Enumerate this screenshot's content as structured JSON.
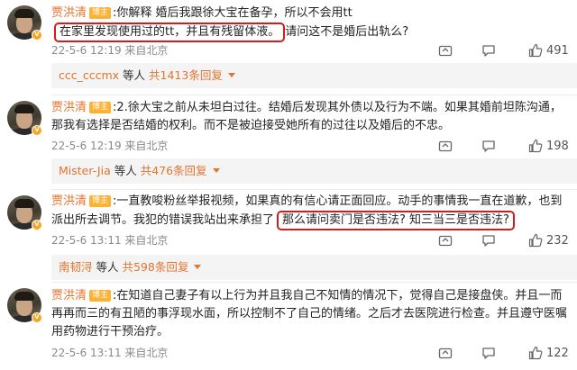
{
  "comments": [
    {
      "username": "贾洪清",
      "badge": "博主",
      "text_before": ":你解释 婚后我跟徐大宝在备孕，所以不会用tt",
      "highlight": "在家里发现使用过的tt，并且有残留体液。",
      "text_after": "请问这不是婚后出轨么?",
      "time": "22-5-6 12:19 来自北京",
      "likes": "491",
      "reply_user": "ccc_cccmx",
      "reply_mid": " 等人 ",
      "reply_count": "共1413条回复"
    },
    {
      "username": "贾洪清",
      "badge": "博主",
      "text_before": ":2.徐大宝之前从未坦白过往。结婚后发现其外债以及行为不端。如果其婚前坦陈沟通，那我有选择是否结婚的权利。而不是被迫接受她所有的过往以及婚后的不忠。",
      "highlight": "",
      "text_after": "",
      "time": "22-5-6 12:19 来自北京",
      "likes": "198",
      "reply_user": "Mister-Jia",
      "reply_mid": " 等人 ",
      "reply_count": "共476条回复"
    },
    {
      "username": "贾洪清",
      "badge": "博主",
      "text_before": ":一直教唆粉丝举报视频，如果真的有信心请正面回应。动手的事情我一直在道歉，也到派出所去调节。我犯的错误我站出来承担了",
      "highlight": "那么请问卖门是否违法? 知三当三是否违法?",
      "text_after": "",
      "time": "22-5-6 13:11 来自北京",
      "likes": "232",
      "reply_user": "南韧浔",
      "reply_mid": " 等人 ",
      "reply_count": "共598条回复"
    },
    {
      "username": "贾洪清",
      "badge": "博主",
      "text_before": ":在知道自己妻子有以上行为并且我自己不知情的情况下，觉得自己是接盘侠。并且一而再再而三的有丑陋的事浮现水面，所以控制不了自己的情绪。之后才去医院进行检查。并且遵守医嘱用药物进行干预治疗。",
      "highlight": "",
      "text_after": "",
      "time": "22-5-6 13:11 来自北京",
      "likes": "122",
      "reply_user": "",
      "reply_mid": "",
      "reply_count": ""
    }
  ]
}
